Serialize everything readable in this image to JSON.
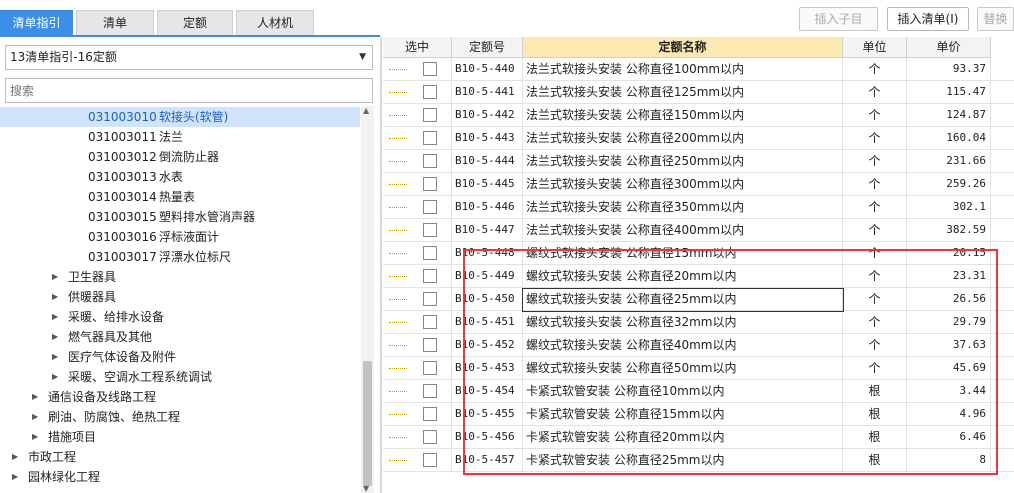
{
  "tabs": [
    {
      "label": "清单指引"
    },
    {
      "label": "清单"
    },
    {
      "label": "定额"
    },
    {
      "label": "人材机"
    }
  ],
  "toolbar": {
    "insert_child": "插入子目",
    "insert_list": "插入清单(I)",
    "replace": "替换"
  },
  "left": {
    "select_value": "13清单指引-16定额",
    "search_placeholder": "搜索",
    "tree": [
      {
        "code": "031003010",
        "label": "软接头(软管)"
      },
      {
        "code": "031003011",
        "label": "法兰"
      },
      {
        "code": "031003012",
        "label": "倒流防止器"
      },
      {
        "code": "031003013",
        "label": "水表"
      },
      {
        "code": "031003014",
        "label": "热量表"
      },
      {
        "code": "031003015",
        "label": "塑料排水管消声器"
      },
      {
        "code": "031003016",
        "label": "浮标液面计"
      },
      {
        "code": "031003017",
        "label": "浮漂水位标尺"
      },
      {
        "code": "",
        "label": "卫生器具"
      },
      {
        "code": "",
        "label": "供暖器具"
      },
      {
        "code": "",
        "label": "采暖、给排水设备"
      },
      {
        "code": "",
        "label": "燃气器具及其他"
      },
      {
        "code": "",
        "label": "医疗气体设备及附件"
      },
      {
        "code": "",
        "label": "采暖、空调水工程系统调试"
      },
      {
        "code": "",
        "label": "通信设备及线路工程"
      },
      {
        "code": "",
        "label": "刷油、防腐蚀、绝热工程"
      },
      {
        "code": "",
        "label": "措施项目"
      },
      {
        "code": "",
        "label": "市政工程"
      },
      {
        "code": "",
        "label": "园林绿化工程"
      }
    ]
  },
  "grid": {
    "headers": {
      "select": "选中",
      "code": "定额号",
      "name": "定额名称",
      "unit": "单位",
      "price": "单价"
    },
    "rows": [
      {
        "code": "B10-5-440",
        "name": "法兰式软接头安装 公称直径100mm以内",
        "unit": "个",
        "price": "93.37"
      },
      {
        "code": "B10-5-441",
        "name": "法兰式软接头安装 公称直径125mm以内",
        "unit": "个",
        "price": "115.47"
      },
      {
        "code": "B10-5-442",
        "name": "法兰式软接头安装 公称直径150mm以内",
        "unit": "个",
        "price": "124.87"
      },
      {
        "code": "B10-5-443",
        "name": "法兰式软接头安装 公称直径200mm以内",
        "unit": "个",
        "price": "160.04"
      },
      {
        "code": "B10-5-444",
        "name": "法兰式软接头安装 公称直径250mm以内",
        "unit": "个",
        "price": "231.66"
      },
      {
        "code": "B10-5-445",
        "name": "法兰式软接头安装 公称直径300mm以内",
        "unit": "个",
        "price": "259.26"
      },
      {
        "code": "B10-5-446",
        "name": "法兰式软接头安装 公称直径350mm以内",
        "unit": "个",
        "price": "302.1"
      },
      {
        "code": "B10-5-447",
        "name": "法兰式软接头安装 公称直径400mm以内",
        "unit": "个",
        "price": "382.59"
      },
      {
        "code": "B10-5-448",
        "name": "螺纹式软接头安装 公称直径15mm以内",
        "unit": "个",
        "price": "20.15"
      },
      {
        "code": "B10-5-449",
        "name": "螺纹式软接头安装 公称直径20mm以内",
        "unit": "个",
        "price": "23.31"
      },
      {
        "code": "B10-5-450",
        "name": "螺纹式软接头安装 公称直径25mm以内",
        "unit": "个",
        "price": "26.56"
      },
      {
        "code": "B10-5-451",
        "name": "螺纹式软接头安装 公称直径32mm以内",
        "unit": "个",
        "price": "29.79"
      },
      {
        "code": "B10-5-452",
        "name": "螺纹式软接头安装 公称直径40mm以内",
        "unit": "个",
        "price": "37.63"
      },
      {
        "code": "B10-5-453",
        "name": "螺纹式软接头安装 公称直径50mm以内",
        "unit": "个",
        "price": "45.69"
      },
      {
        "code": "B10-5-454",
        "name": "卡紧式软管安装 公称直径10mm以内",
        "unit": "根",
        "price": "3.44"
      },
      {
        "code": "B10-5-455",
        "name": "卡紧式软管安装 公称直径15mm以内",
        "unit": "根",
        "price": "4.96"
      },
      {
        "code": "B10-5-456",
        "name": "卡紧式软管安装 公称直径20mm以内",
        "unit": "根",
        "price": "6.46"
      },
      {
        "code": "B10-5-457",
        "name": "卡紧式软管安装 公称直径25mm以内",
        "unit": "根",
        "price": "8"
      }
    ]
  },
  "colors": {
    "accent": "#3d8ee6",
    "highlight_box": "#e83a3a",
    "header_name_bg": "#fbe8b3",
    "tree_selected_bg": "#cfe4fb"
  }
}
